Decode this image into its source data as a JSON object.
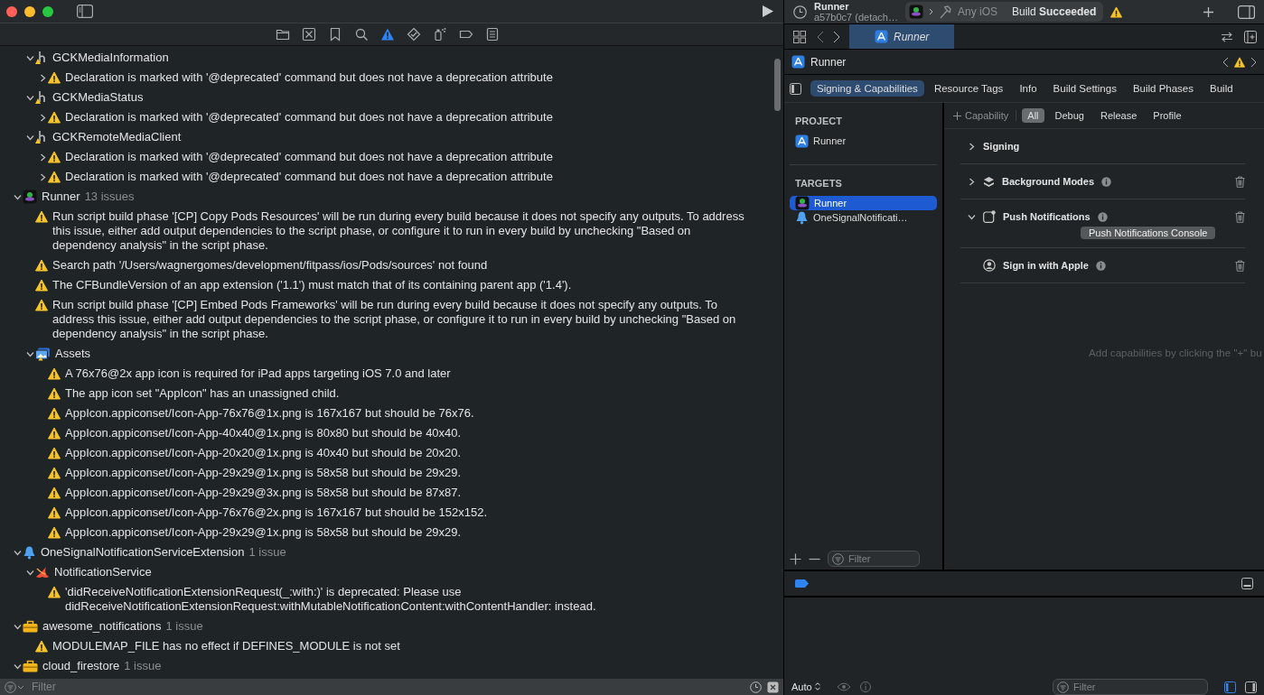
{
  "navigator": {
    "tabs": [
      {
        "kind": "folder",
        "selected": false
      },
      {
        "kind": "source-control",
        "selected": false
      },
      {
        "kind": "bookmark",
        "selected": false
      },
      {
        "kind": "search",
        "selected": false
      },
      {
        "kind": "issues",
        "selected": true
      },
      {
        "kind": "tests",
        "selected": false
      },
      {
        "kind": "debug",
        "selected": false
      },
      {
        "kind": "breakpoints",
        "selected": false
      },
      {
        "kind": "reports",
        "selected": false
      }
    ],
    "continued": [
      {
        "kind": "header",
        "label": "GCKMediaInformation",
        "expanded": true,
        "children": [
          {
            "kind": "issue",
            "text": "Declaration is marked with '@deprecated' command but does not have a deprecation attribute",
            "expanded": false
          }
        ]
      },
      {
        "kind": "header",
        "label": "GCKMediaStatus",
        "expanded": true,
        "children": [
          {
            "kind": "issue",
            "text": "Declaration is marked with '@deprecated' command but does not have a deprecation attribute",
            "expanded": false
          }
        ]
      },
      {
        "kind": "header",
        "label": "GCKRemoteMediaClient",
        "expanded": true,
        "children": [
          {
            "kind": "issue",
            "text": "Declaration is marked with '@deprecated' command but does not have a deprecation attribute",
            "expanded": false
          },
          {
            "kind": "issue",
            "text": "Declaration is marked with '@deprecated' command but does not have a deprecation attribute",
            "expanded": false
          }
        ]
      }
    ],
    "groups": [
      {
        "kind": "app",
        "label": "Runner",
        "count": "13 issues",
        "expanded": true,
        "children": [
          {
            "kind": "issue",
            "text": "Run script build phase '[CP] Copy Pods Resources' will be run during every build because it does not specify any outputs. To address this issue, either add output dependencies to the script phase, or configure it to run in every build by unchecking \"Based on dependency analysis\" in the script phase."
          },
          {
            "kind": "issue",
            "text": "Search path '/Users/wagnergomes/development/fitpass/ios/Pods/sources' not found"
          },
          {
            "kind": "issue",
            "text": "The CFBundleVersion of an app extension ('1.1') must match that of its containing parent app ('1.4')."
          },
          {
            "kind": "issue",
            "text": "Run script build phase '[CP] Embed Pods Frameworks' will be run during every build because it does not specify any outputs. To address this issue, either add output dependencies to the script phase, or configure it to run in every build by unchecking \"Based on dependency analysis\" in the script phase."
          },
          {
            "kind": "assets",
            "label": "Assets",
            "expanded": true,
            "children": [
              {
                "kind": "issue",
                "text": "A 76x76@2x app icon is required for iPad apps targeting iOS 7.0 and later"
              },
              {
                "kind": "issue",
                "text": "The app icon set \"AppIcon\" has an unassigned child."
              },
              {
                "kind": "issue",
                "text": "AppIcon.appiconset/Icon-App-76x76@1x.png is 167x167 but should be 76x76."
              },
              {
                "kind": "issue",
                "text": "AppIcon.appiconset/Icon-App-40x40@1x.png is 80x80 but should be 40x40."
              },
              {
                "kind": "issue",
                "text": "AppIcon.appiconset/Icon-App-20x20@1x.png is 40x40 but should be 20x20."
              },
              {
                "kind": "issue",
                "text": "AppIcon.appiconset/Icon-App-29x29@1x.png is 58x58 but should be 29x29."
              },
              {
                "kind": "issue",
                "text": "AppIcon.appiconset/Icon-App-29x29@3x.png is 58x58 but should be 87x87."
              },
              {
                "kind": "issue",
                "text": "AppIcon.appiconset/Icon-App-76x76@2x.png is 167x167 but should be 152x152."
              },
              {
                "kind": "issue",
                "text": "AppIcon.appiconset/Icon-App-29x29@1x.png is 58x58 but should be 29x29."
              }
            ]
          }
        ]
      },
      {
        "kind": "extension",
        "label": "OneSignalNotificationServiceExtension",
        "count": "1 issue",
        "expanded": true,
        "children": [
          {
            "kind": "swift",
            "label": "NotificationService",
            "expanded": true,
            "children": [
              {
                "kind": "issue",
                "text": "'didReceiveNotificationExtensionRequest(_:with:)' is deprecated: Please use didReceiveNotificationExtensionRequest:withMutableNotificationContent:withContentHandler: instead."
              }
            ]
          }
        ]
      },
      {
        "kind": "pod",
        "label": "awesome_notifications",
        "count": "1 issue",
        "expanded": true,
        "children": [
          {
            "kind": "issue",
            "text": "MODULEMAP_FILE has no effect if DEFINES_MODULE is not set"
          }
        ]
      },
      {
        "kind": "pod",
        "label": "cloud_firestore",
        "count": "1 issue",
        "expanded": true
      }
    ],
    "filter": {
      "placeholder": "Filter"
    }
  },
  "toolbar": {
    "scheme_title": "Runner",
    "scheme_subtitle": "a57b0c7 (detach…",
    "destination": "Any iOS",
    "status": "Build **Succeeded**"
  },
  "editor_tabs": [
    {
      "label": "Runner",
      "selected": true
    }
  ],
  "jump_bar": {
    "label": "Runner"
  },
  "settings_tabs": [
    {
      "label": "Signing & Capabilities",
      "selected": true
    },
    {
      "label": "Resource Tags",
      "selected": false
    },
    {
      "label": "Info",
      "selected": false
    },
    {
      "label": "Build Settings",
      "selected": false
    },
    {
      "label": "Build Phases",
      "selected": false
    },
    {
      "label": "Build",
      "selected": false
    }
  ],
  "targets": {
    "project_heading": "PROJECT",
    "project": [
      {
        "kind": "project",
        "label": "Runner",
        "selected": false
      }
    ],
    "targets_heading": "TARGETS",
    "targets": [
      {
        "kind": "app",
        "label": "Runner",
        "selected": true
      },
      {
        "kind": "extension",
        "label": "OneSignalNotificati…",
        "selected": false
      }
    ],
    "filter": {
      "placeholder": "Filter"
    }
  },
  "capability_bar": {
    "add_label": "Capability",
    "configs": [
      {
        "label": "All",
        "selected": true
      },
      {
        "label": "Debug",
        "selected": false
      },
      {
        "label": "Release",
        "selected": false
      },
      {
        "label": "Profile",
        "selected": false
      }
    ]
  },
  "capabilities": [
    {
      "kind": "signing",
      "label": "Signing",
      "expanded": false,
      "info": false,
      "removable": false
    },
    {
      "kind": "background_modes",
      "label": "Background Modes",
      "expanded": false,
      "info": true,
      "removable": true
    },
    {
      "kind": "push",
      "label": "Push Notifications",
      "expanded": true,
      "info": true,
      "removable": true,
      "button": "Push Notifications Console"
    },
    {
      "kind": "apple_signin",
      "label": "Sign in with Apple",
      "info": true,
      "removable": true
    }
  ],
  "empty_hint": "Add capabilities by clicking the \"+\" bu",
  "debug": {
    "output_mode": "Auto",
    "filter": {
      "placeholder": "Filter"
    }
  }
}
